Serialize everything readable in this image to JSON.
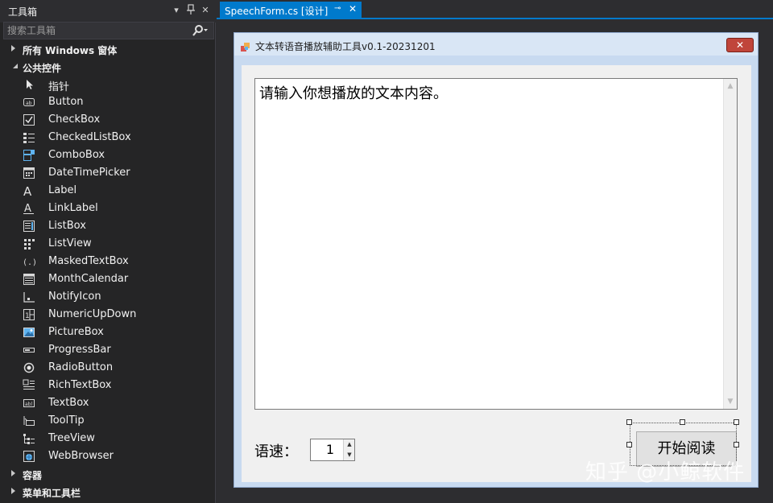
{
  "toolbox": {
    "title": "工具箱",
    "search_placeholder": "搜索工具箱",
    "categories": [
      {
        "label": "所有 Windows 窗体",
        "expanded": false
      },
      {
        "label": "公共控件",
        "expanded": true
      }
    ],
    "items": [
      {
        "label": "指针",
        "icon": "pointer-icon"
      },
      {
        "label": "Button",
        "icon": "button-icon"
      },
      {
        "label": "CheckBox",
        "icon": "checkbox-icon"
      },
      {
        "label": "CheckedListBox",
        "icon": "checked-listbox-icon"
      },
      {
        "label": "ComboBox",
        "icon": "combobox-icon"
      },
      {
        "label": "DateTimePicker",
        "icon": "datetimepicker-icon"
      },
      {
        "label": "Label",
        "icon": "label-icon"
      },
      {
        "label": "LinkLabel",
        "icon": "linklabel-icon"
      },
      {
        "label": "ListBox",
        "icon": "listbox-icon"
      },
      {
        "label": "ListView",
        "icon": "listview-icon"
      },
      {
        "label": "MaskedTextBox",
        "icon": "maskedtextbox-icon"
      },
      {
        "label": "MonthCalendar",
        "icon": "monthcalendar-icon"
      },
      {
        "label": "NotifyIcon",
        "icon": "notifyicon-icon"
      },
      {
        "label": "NumericUpDown",
        "icon": "numericupdown-icon"
      },
      {
        "label": "PictureBox",
        "icon": "picturebox-icon"
      },
      {
        "label": "ProgressBar",
        "icon": "progressbar-icon"
      },
      {
        "label": "RadioButton",
        "icon": "radiobutton-icon"
      },
      {
        "label": "RichTextBox",
        "icon": "richtextbox-icon"
      },
      {
        "label": "TextBox",
        "icon": "textbox-icon"
      },
      {
        "label": "ToolTip",
        "icon": "tooltip-icon"
      },
      {
        "label": "TreeView",
        "icon": "treeview-icon"
      },
      {
        "label": "WebBrowser",
        "icon": "webbrowser-icon"
      }
    ],
    "bottom_categories": [
      {
        "label": "容器",
        "expanded": false
      },
      {
        "label": "菜单和工具栏",
        "expanded": false
      }
    ]
  },
  "document_tab": {
    "label": "SpeechForm.cs [设计]",
    "pin": "⊸",
    "close": "✕"
  },
  "form": {
    "title": "文本转语音播放辅助工具v0.1-20231201",
    "close_glyph": "✕",
    "textbox_text": "请输入你想播放的文本内容。",
    "speed_label": "语速：",
    "speed_value": "1",
    "start_button": "开始阅读"
  },
  "watermark": "知乎 @小鲸软件",
  "colors": {
    "accent": "#007acc",
    "panel_bg": "#252526",
    "form_bg": "#f0f0f0"
  }
}
